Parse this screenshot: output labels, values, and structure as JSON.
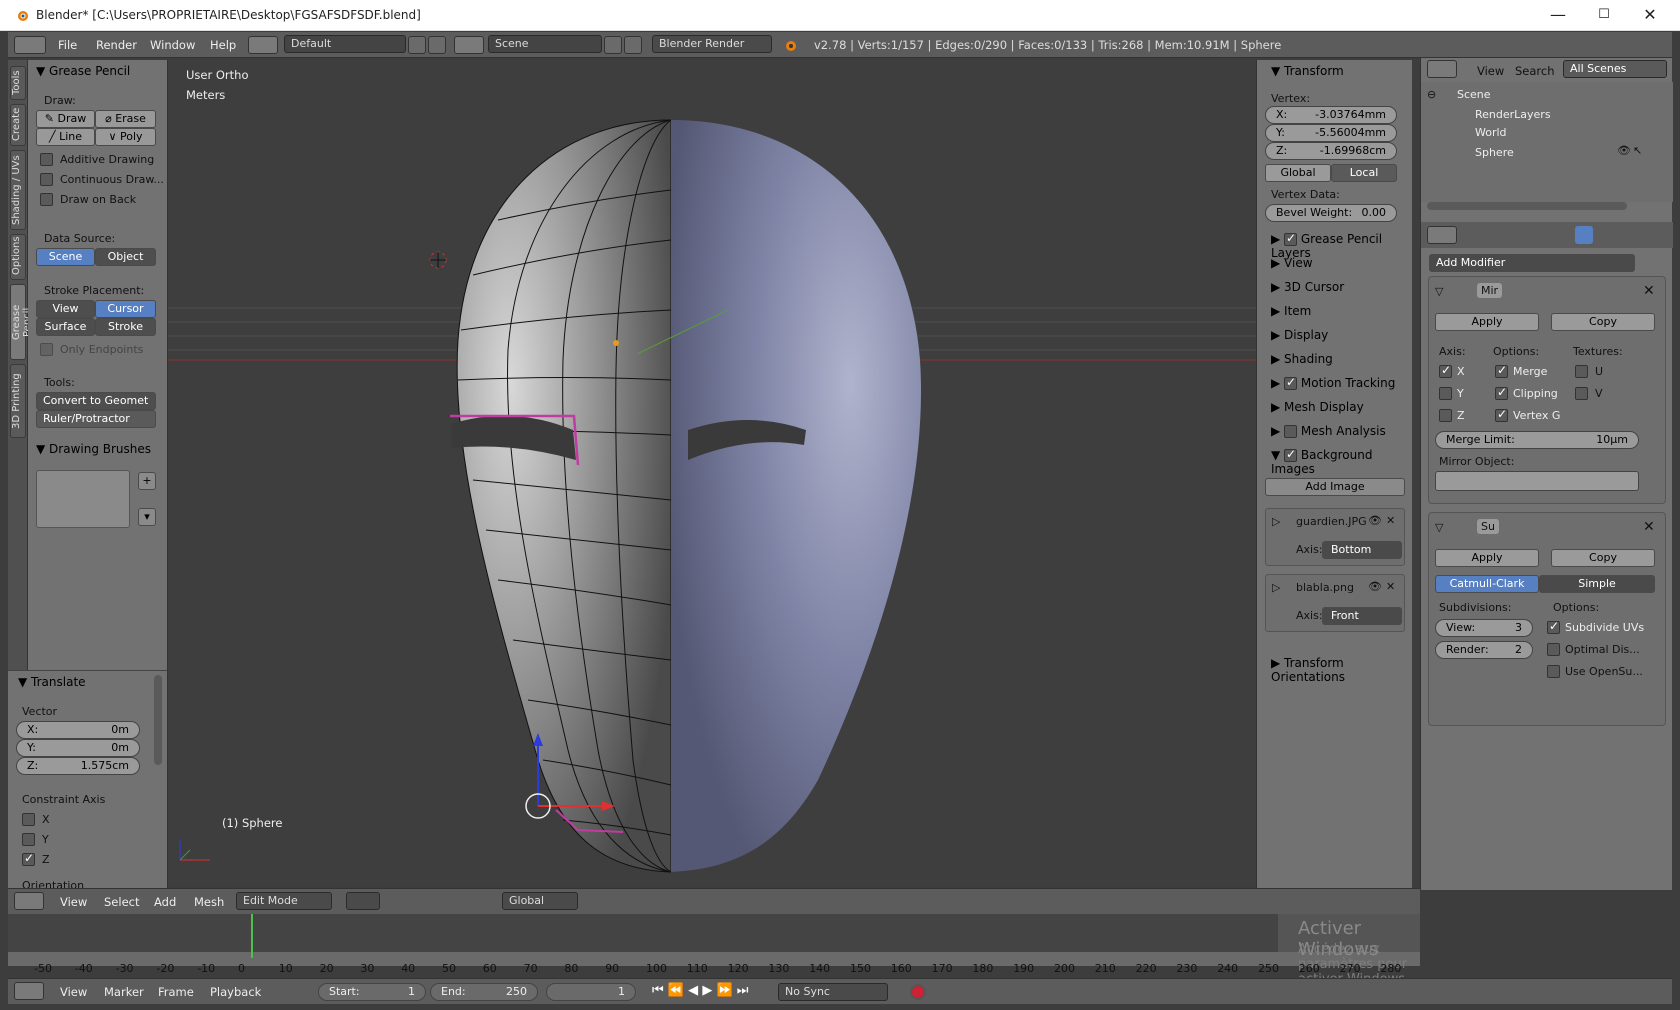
{
  "window": {
    "title": "Blender* [C:\\Users\\PROPRIETAIRE\\Desktop\\FGSAFSDFSDF.blend]",
    "min": "—",
    "max": "☐",
    "close": "✕"
  },
  "menubar": {
    "items": [
      "File",
      "Render",
      "Window",
      "Help"
    ],
    "layout": "Default",
    "scene": "Scene",
    "engine": "Blender Render",
    "stats": "v2.78 | Verts:1/157 | Edges:0/290 | Faces:0/133 | Tris:268 | Mem:10.91M | Sphere"
  },
  "tabs": [
    "Tools",
    "Create",
    "Shading / UVs",
    "Options",
    "Grease Pencil",
    "3D Printing"
  ],
  "grease": {
    "title": "Grease Pencil",
    "draw_label": "Draw:",
    "draw": "Draw",
    "erase": "Erase",
    "line": "Line",
    "poly": "Poly",
    "additive": "Additive Drawing",
    "continuous": "Continuous Draw...",
    "back": "Draw on Back",
    "ds_label": "Data Source:",
    "scene": "Scene",
    "object": "Object",
    "sp_label": "Stroke Placement:",
    "view": "View",
    "cursor": "Cursor",
    "surface": "Surface",
    "stroke": "Stroke",
    "endpoints": "Only Endpoints",
    "tools_label": "Tools:",
    "convert": "Convert to Geomet",
    "ruler": "Ruler/Protractor",
    "brushes": "Drawing Brushes"
  },
  "translate": {
    "title": "Translate",
    "vector": "Vector",
    "x_l": "X:",
    "x": "0m",
    "y_l": "Y:",
    "y": "0m",
    "z_l": "Z:",
    "z": "1.575cm",
    "constraint": "Constraint Axis",
    "ax": "X",
    "ay": "Y",
    "az": "Z",
    "orientation": "Orientation"
  },
  "viewport": {
    "view": "User Ortho",
    "units": "Meters",
    "object": "(1) Sphere"
  },
  "npanel": {
    "transform": "Transform",
    "vertex": "Vertex:",
    "x_l": "X:",
    "x": "-3.03764mm",
    "y_l": "Y:",
    "y": "-5.56004mm",
    "z_l": "Z:",
    "z": "-1.69968cm",
    "global": "Global",
    "local": "Local",
    "vdata": "Vertex Data:",
    "bevel_l": "Bevel Weight:",
    "bevel": "0.00",
    "sections": [
      "Grease Pencil Layers",
      "View",
      "3D Cursor",
      "Item",
      "Display",
      "Shading",
      "Motion Tracking",
      "Mesh Display",
      "Mesh Analysis",
      "Background Images"
    ],
    "add_image": "Add Image",
    "img1": "guardien.JPG",
    "img1_axis": "Bottom",
    "img2": "blabla.png",
    "img2_axis": "Front",
    "axis": "Axis:",
    "orient": "Transform Orientations"
  },
  "outliner": {
    "view": "View",
    "search": "Search",
    "all": "All Scenes",
    "scene": "Scene",
    "renderlayers": "RenderLayers",
    "world": "World",
    "sphere": "Sphere"
  },
  "props": {
    "add_modifier": "Add Modifier",
    "mirror": "Mir",
    "apply": "Apply",
    "copy": "Copy",
    "axis": "Axis:",
    "options": "Options:",
    "textures": "Textures:",
    "x": "X",
    "y": "Y",
    "z": "Z",
    "merge": "Merge",
    "clipping": "Clipping",
    "vertexg": "Vertex G",
    "u": "U",
    "v": "V",
    "merge_limit_l": "Merge Limit:",
    "merge_limit": "10µm",
    "mirror_obj": "Mirror Object:",
    "subsurf": "Su",
    "catmull": "Catmull-Clark",
    "simple": "Simple",
    "subdivisions": "Subdivisions:",
    "view_l": "View:",
    "view": "3",
    "render_l": "Render:",
    "render": "2",
    "subuv": "Subdivide UVs",
    "optimal": "Optimal Dis...",
    "opensubdiv": "Use OpenSu..."
  },
  "vpheader": {
    "view": "View",
    "select": "Select",
    "add": "Add",
    "mesh": "Mesh",
    "mode": "Edit Mode",
    "orient": "Global"
  },
  "timeline": {
    "ticks": [
      "-50",
      "-40",
      "-30",
      "-20",
      "-10",
      "0",
      "10",
      "20",
      "30",
      "40",
      "50",
      "60",
      "70",
      "80",
      "90",
      "100",
      "110",
      "120",
      "130",
      "140",
      "150",
      "160",
      "170",
      "180",
      "190",
      "200",
      "210",
      "220",
      "230",
      "240",
      "250",
      "260",
      "270",
      "280"
    ],
    "watermark1": "Activer Windows",
    "watermark2": "Accédez aux paramètres pour activer Windows.",
    "view": "View",
    "marker": "Marker",
    "frame": "Frame",
    "playback": "Playback",
    "start_l": "Start:",
    "start": "1",
    "end_l": "End:",
    "end": "250",
    "current": "1",
    "sync": "No Sync",
    "current_frame_value": 1
  },
  "colors": {
    "accent": "#5680c2",
    "selected_edge": "#c03ca0",
    "mesh": "#7f84a6"
  }
}
